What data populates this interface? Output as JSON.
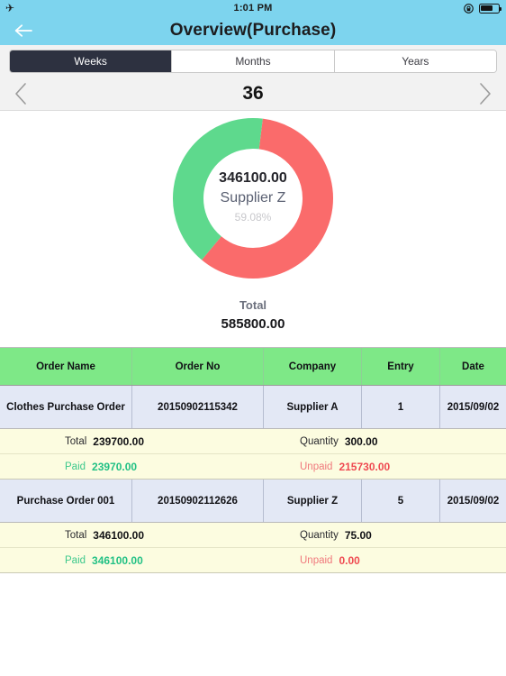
{
  "status_bar": {
    "airplane_icon": "airplane-mode-icon",
    "time": "1:01 PM",
    "rotation_lock_icon": "rotation-lock-icon",
    "battery_icon": "battery-icon"
  },
  "nav": {
    "back_icon": "back-arrow-icon",
    "title": "Overview(Purchase)"
  },
  "segments": {
    "items": [
      {
        "label": "Weeks",
        "active": true
      },
      {
        "label": "Months",
        "active": false
      },
      {
        "label": "Years",
        "active": false
      }
    ]
  },
  "pager": {
    "prev_icon": "chevron-left-icon",
    "next_icon": "chevron-right-icon",
    "label": "36"
  },
  "chart_data": {
    "type": "pie",
    "title": "",
    "subtype": "donut",
    "center_value": "346100.00",
    "center_name": "Supplier Z",
    "center_percent": "59.08%",
    "categories": [
      "Supplier Z",
      "Supplier A"
    ],
    "values": [
      346100.0,
      239700.0
    ],
    "percents": [
      59.08,
      40.92
    ],
    "colors": [
      "#fa6b6b",
      "#5ed98d"
    ],
    "legend": "none",
    "total_label": "Total",
    "total_value": "585800.00"
  },
  "table": {
    "headers": [
      "Order Name",
      "Order No",
      "Company",
      "Entry",
      "Date"
    ],
    "rows": [
      {
        "order_name": "Clothes Purchase Order",
        "order_no": "20150902115342",
        "company": "Supplier A",
        "entry": "1",
        "date": "2015/09/02",
        "total_label": "Total",
        "total_value": "239700.00",
        "quantity_label": "Quantity",
        "quantity_value": "300.00",
        "paid_label": "Paid",
        "paid_value": "23970.00",
        "unpaid_label": "Unpaid",
        "unpaid_value": "215730.00"
      },
      {
        "order_name": "Purchase Order 001",
        "order_no": "20150902112626",
        "company": "Supplier Z",
        "entry": "5",
        "date": "2015/09/02",
        "total_label": "Total",
        "total_value": "346100.00",
        "quantity_label": "Quantity",
        "quantity_value": "75.00",
        "paid_label": "Paid",
        "paid_value": "346100.00",
        "unpaid_label": "Unpaid",
        "unpaid_value": "0.00"
      }
    ]
  },
  "theme": {
    "navbar": "#7dd4ee",
    "header_green": "#7ee887",
    "row_lavender": "#e3e8f5",
    "sub_cream": "#fcfce0",
    "donut_red": "#fa6b6b",
    "donut_green": "#5ed98d",
    "active_segment": "#2d3140"
  }
}
